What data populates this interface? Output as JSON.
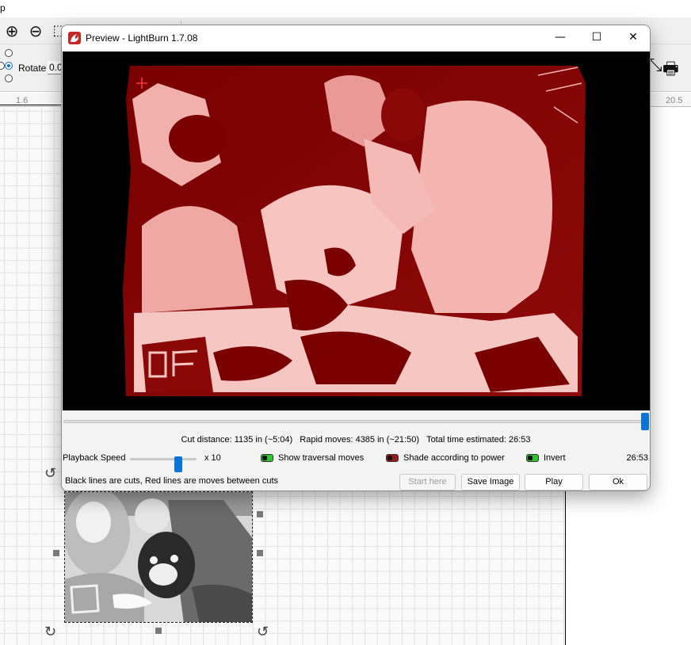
{
  "background": {
    "top_strip_text": "p",
    "rotate_label": "Rotate",
    "rotate_value": "0.0",
    "ruler_left": "1.6",
    "ruler_right": "20.5"
  },
  "dialog": {
    "title": "Preview - LightBurn 1.7.08",
    "minimize": "—",
    "maximize": "☐",
    "close": "✕",
    "stats": {
      "cut_distance": "Cut distance: 1135 in (~5:04)",
      "rapid_moves": "Rapid moves: 4385 in (~21:50)",
      "total_time": "Total time estimated: 26:53"
    },
    "scrub_progress": 1.0,
    "playback_label": "Playback Speed",
    "speed_value": "x 10",
    "options": [
      {
        "label": "Show traversal moves",
        "state": "on",
        "color": "#2fc42f"
      },
      {
        "label": "Shade according to power",
        "state": "on",
        "color": "#9b1b1b"
      },
      {
        "label": "Invert",
        "state": "on",
        "color": "#2fc42f"
      }
    ],
    "elapsed_time": "26:53",
    "legend_text": "Black lines are cuts, Red lines are moves between cuts",
    "buttons": {
      "start_here": "Start here",
      "save_image": "Save Image",
      "play": "Play",
      "ok": "Ok"
    }
  },
  "colors": {
    "accent": "#0b74d6",
    "preview_dark": "#7a0000",
    "preview_light": "#f4b4b0"
  }
}
